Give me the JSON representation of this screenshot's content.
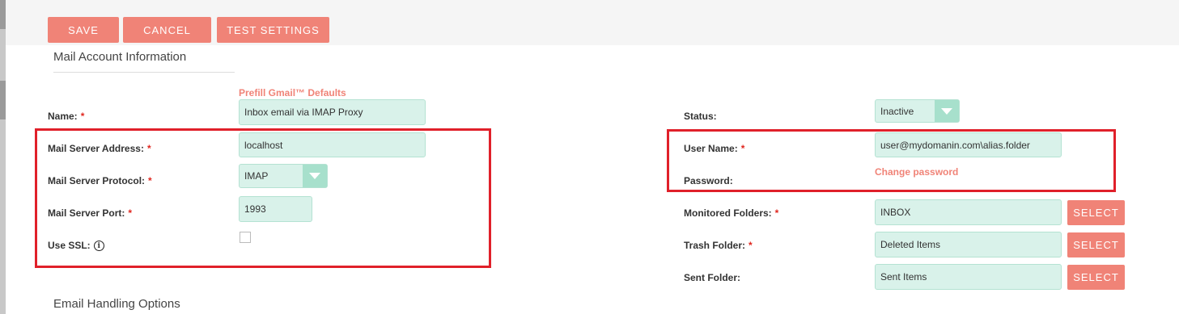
{
  "toolbar": {
    "save_label": "SAVE",
    "cancel_label": "CANCEL",
    "test_settings_label": "TEST SETTINGS"
  },
  "sections": {
    "mail_account_info": "Mail Account Information",
    "email_handling": "Email Handling Options"
  },
  "prefill_link": "Prefill Gmail™ Defaults",
  "left_form": {
    "name_label": "Name:",
    "name_value": "Inbox email via IMAP Proxy",
    "server_address_label": "Mail Server Address:",
    "server_address_value": "localhost",
    "protocol_label": "Mail Server Protocol:",
    "protocol_value": "IMAP",
    "port_label": "Mail Server Port:",
    "port_value": "1993",
    "ssl_label": "Use SSL:",
    "ssl_checked": false
  },
  "right_form": {
    "status_label": "Status:",
    "status_value": "Inactive",
    "username_label": "User Name:",
    "username_value": "user@mydomanin.com\\alias.folder",
    "password_label": "Password:",
    "change_password_link": "Change password",
    "monitored_label": "Monitored Folders:",
    "monitored_value": "INBOX",
    "trash_label": "Trash Folder:",
    "trash_value": "Deleted Items",
    "sent_label": "Sent Folder:",
    "sent_value": "Sent Items",
    "select_label": "SELECT"
  },
  "required_marker": "*",
  "info_glyph": "i",
  "colors": {
    "accent": "#f08377",
    "field_bg": "#d9f2ea",
    "highlight": "#e0202a",
    "required": "#e0271f"
  }
}
